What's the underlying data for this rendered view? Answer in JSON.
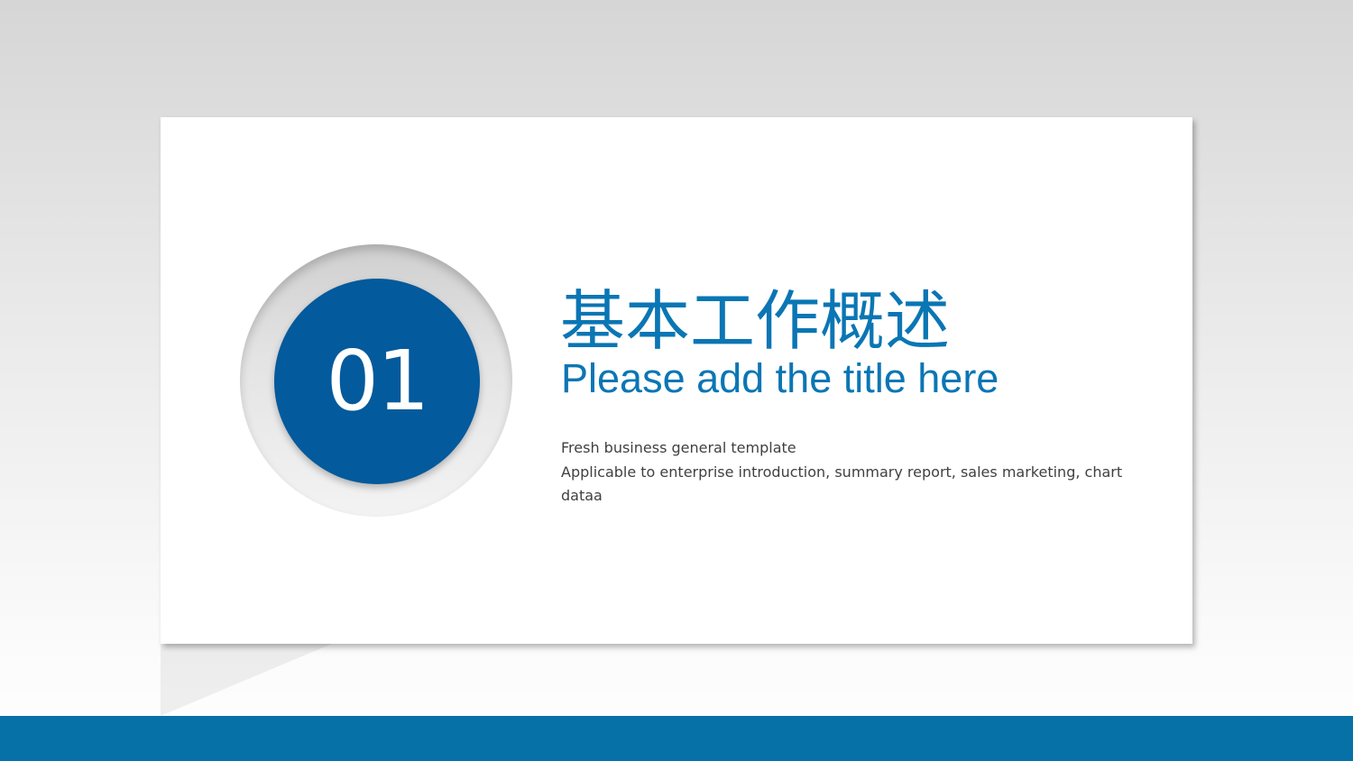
{
  "slide": {
    "number": "01",
    "title_cn": "基本工作概述",
    "title_en": "Please add the title here",
    "description_line1": "Fresh business general template",
    "description_line2": "Applicable to enterprise introduction, summary report, sales marketing, chart dataa"
  },
  "colors": {
    "accent": "#0a76b4",
    "circle_fill": "#035a9c",
    "bottom_bar": "#0571a7",
    "body_text": "#404040"
  }
}
